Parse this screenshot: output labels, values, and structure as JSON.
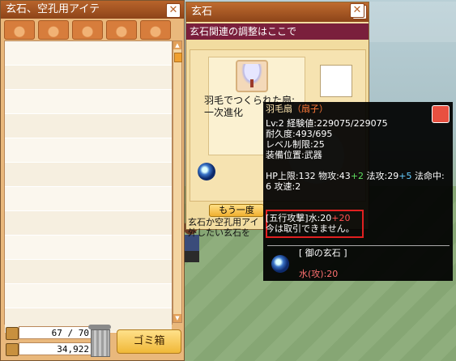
{
  "inventory_window": {
    "title": "玄石、空孔用アイテ",
    "close_label": "✕",
    "capacity": "67 / 70",
    "money": "34,922",
    "trash_button": "ゴミ箱"
  },
  "genseki_window": {
    "title": "玄石",
    "close_label": "✕",
    "subtitle": "玄石関連の調整はここで",
    "item_name_line1": "羽毛でつくられた扇:",
    "item_name_line2": "一次進化",
    "again_button": "もう一度",
    "note_line1": "玄石か空孔用アイ",
    "note_line2": "外したい玄石を"
  },
  "right_window": {
    "close_label": "✕"
  },
  "tooltip": {
    "name": "羽毛扇",
    "category": "（扇子）",
    "level_exp": "Lv:2 経験値:229075/229075",
    "durability": "耐久度:493/695",
    "level_req": "レベル制限:25",
    "equip_pos": "装備位置:武器",
    "stats_a": "HP上限:132 物攻:43",
    "stats_a_plus": "+2",
    "stats_b": " 法攻:29",
    "stats_b_plus": "+5",
    "stats_c": " 法命中:",
    "stats_d": "6 攻速:2",
    "element_attack": "[五行攻撃]水:20",
    "element_plus": "+20",
    "trade_notice": "今は取引できません。",
    "gem_section_title": "[ 御の玄石 ]",
    "gem_effect": "水(攻):20"
  }
}
